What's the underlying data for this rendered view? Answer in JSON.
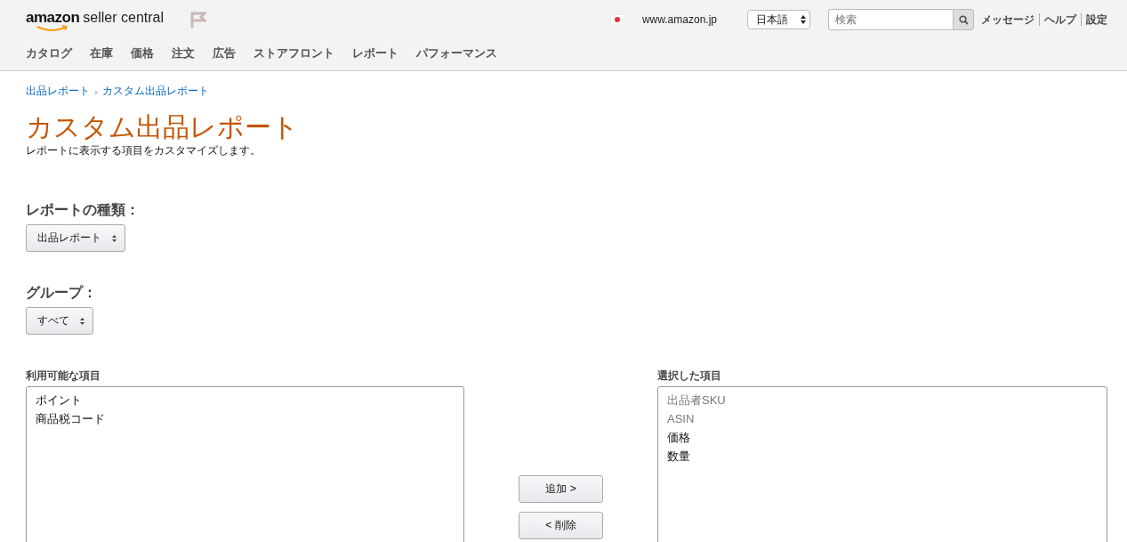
{
  "header": {
    "logo": {
      "brand": "amazon",
      "product": "seller central"
    },
    "marketplace": "www.amazon.jp",
    "language": "日本語",
    "search": {
      "placeholder": "検索"
    },
    "links": [
      "メッセージ",
      "ヘルプ",
      "設定"
    ]
  },
  "nav": [
    "カタログ",
    "在庫",
    "価格",
    "注文",
    "広告",
    "ストアフロント",
    "レポート",
    "パフォーマンス"
  ],
  "breadcrumb": [
    "出品レポート",
    "カスタム出品レポート"
  ],
  "breadcrumb_separator": "›",
  "title": "カスタム出品レポート",
  "subtitle": "レポートに表示する項目をカスタマイズします。",
  "report_type": {
    "label": "レポートの種類：",
    "value": "出品レポート"
  },
  "group": {
    "label": "グループ：",
    "value": "すべて"
  },
  "available": {
    "label": "利用可能な項目",
    "items": [
      {
        "text": "ポイント",
        "disabled": false
      },
      {
        "text": "商品税コード",
        "disabled": false
      }
    ]
  },
  "buttons": [
    "追加 >",
    "< 削除"
  ],
  "selected": {
    "label": "選択した項目",
    "items": [
      {
        "text": "出品者SKU",
        "disabled": true
      },
      {
        "text": "ASIN",
        "disabled": true
      },
      {
        "text": "価格",
        "disabled": false
      },
      {
        "text": "数量",
        "disabled": false
      }
    ]
  }
}
